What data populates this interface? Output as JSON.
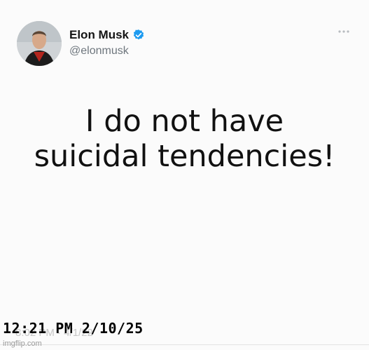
{
  "author": {
    "name": "Elon Musk",
    "handle": "@elonmusk",
    "verified": true,
    "avatar_icon": "profile-photo",
    "badge_icon": "verified-badge-icon",
    "more_icon": "more-horizontal-icon"
  },
  "tweet": {
    "line1": "I do not have",
    "line2": "suicidal tendencies!"
  },
  "footer": {
    "faded_time": "8:02 PM · 4/1/22",
    "timestamp_overlay": "12:21 PM 2/10/25",
    "watermark": "imgflip.com"
  },
  "colors": {
    "verified_blue": "#1d9bf0",
    "handle_gray": "#6e767d",
    "text": "#111111"
  }
}
